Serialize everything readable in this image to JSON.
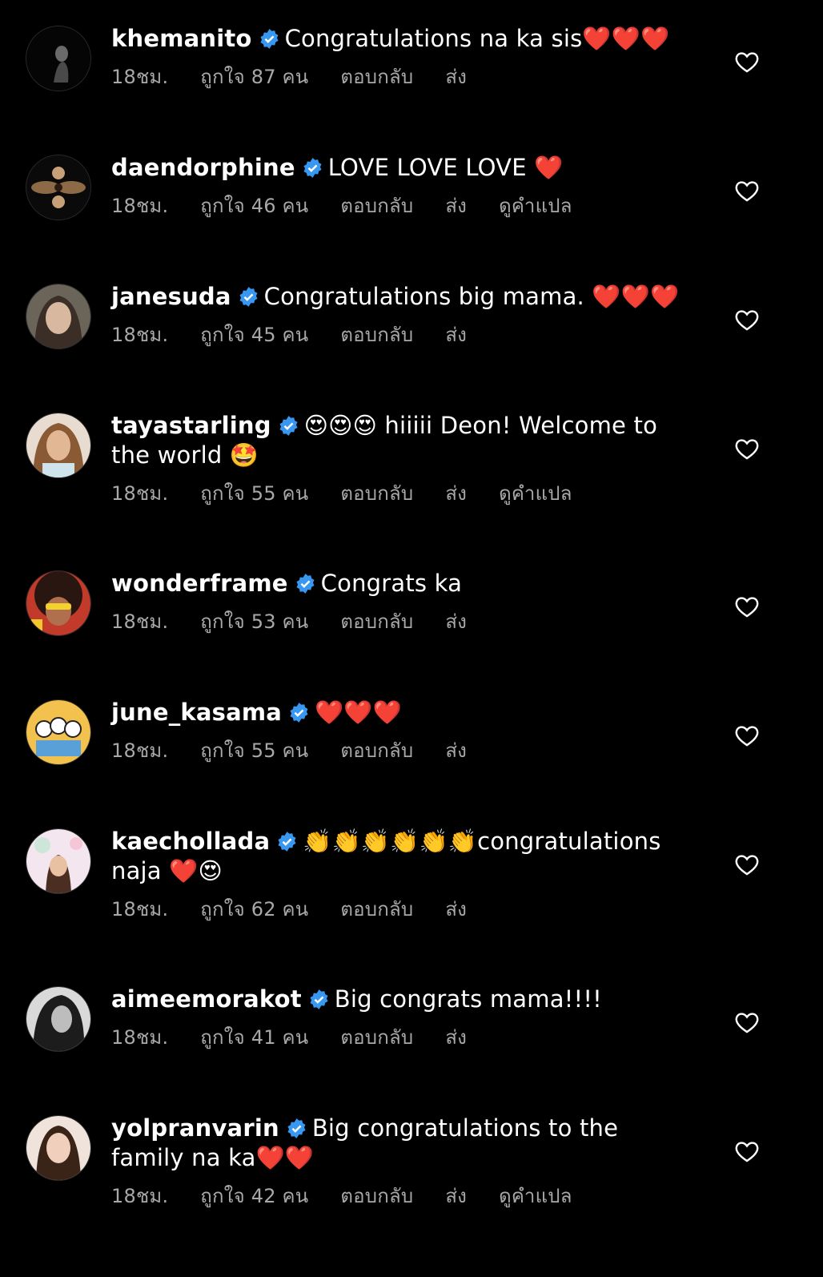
{
  "comments": [
    {
      "username": "khemanito",
      "text": "Congratulations na ka sis❤️❤️❤️",
      "time": "18ชม.",
      "likes": "ถูกใจ 87 คน",
      "reply": "ตอบกลับ",
      "send": "ส่ง",
      "translate": ""
    },
    {
      "username": "daendorphine",
      "text": "LOVE LOVE LOVE ❤️",
      "time": "18ชม.",
      "likes": "ถูกใจ 46 คน",
      "reply": "ตอบกลับ",
      "send": "ส่ง",
      "translate": "ดูคำแปล"
    },
    {
      "username": "janesuda",
      "text": "Congratulations big mama. ❤️❤️❤️",
      "time": "18ชม.",
      "likes": "ถูกใจ 45 คน",
      "reply": "ตอบกลับ",
      "send": "ส่ง",
      "translate": ""
    },
    {
      "username": "tayastarling",
      "text": "😍😍😍 hiiiii Deon! Welcome to the world 🤩",
      "time": "18ชม.",
      "likes": "ถูกใจ 55 คน",
      "reply": "ตอบกลับ",
      "send": "ส่ง",
      "translate": "ดูคำแปล"
    },
    {
      "username": "wonderframe",
      "text": "Congrats ka",
      "time": "18ชม.",
      "likes": "ถูกใจ 53 คน",
      "reply": "ตอบกลับ",
      "send": "ส่ง",
      "translate": ""
    },
    {
      "username": "june_kasama",
      "text": "❤️❤️❤️",
      "time": "18ชม.",
      "likes": "ถูกใจ 55 คน",
      "reply": "ตอบกลับ",
      "send": "ส่ง",
      "translate": ""
    },
    {
      "username": "kaechollada",
      "text": "👏👏👏👏👏👏congratulations naja ❤️😍",
      "time": "18ชม.",
      "likes": "ถูกใจ 62 คน",
      "reply": "ตอบกลับ",
      "send": "ส่ง",
      "translate": ""
    },
    {
      "username": "aimeemorakot",
      "text": "Big congrats mama!!!!",
      "time": "18ชม.",
      "likes": "ถูกใจ 41 คน",
      "reply": "ตอบกลับ",
      "send": "ส่ง",
      "translate": ""
    },
    {
      "username": "yolpranvarin",
      "text": "Big congratulations to the family na ka❤️❤️",
      "time": "18ชม.",
      "likes": "ถูกใจ 42 คน",
      "reply": "ตอบกลับ",
      "send": "ส่ง",
      "translate": "ดูคำแปล"
    }
  ],
  "colors": {
    "background": "#000000",
    "verified": "#3897f0",
    "meta": "#a8a8a8"
  },
  "icons": {
    "verified": "verified-badge-icon",
    "like": "heart-outline-icon"
  }
}
